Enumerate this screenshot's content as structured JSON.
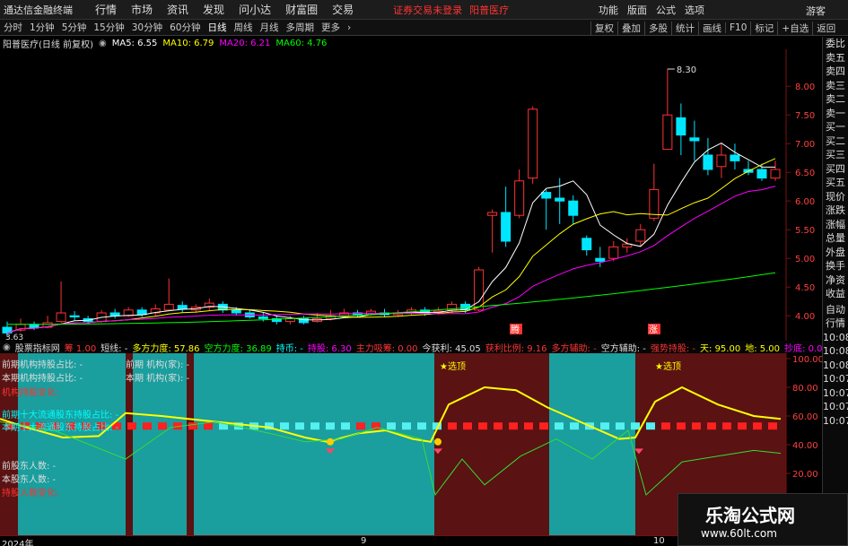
{
  "menubar": {
    "app_title": "通达信金融终端",
    "items": [
      "行情",
      "市场",
      "资讯",
      "发现",
      "问小达",
      "财富圈",
      "交易"
    ],
    "alert": "证券交易未登录",
    "stock": "阳普医疗",
    "right": [
      "功能",
      "版面",
      "公式",
      "选项",
      "游客"
    ]
  },
  "toolbar": {
    "periods": [
      "分时",
      "1分钟",
      "5分钟",
      "15分钟",
      "30分钟",
      "60分钟",
      "日线",
      "周线",
      "月线",
      "多周期",
      "更多"
    ],
    "active": "日线",
    "right": [
      "复权",
      "叠加",
      "多股",
      "统计",
      "画线",
      "F10",
      "标记",
      "+自选",
      "返回"
    ]
  },
  "main_chart": {
    "stock_label": "阳普医疗(日线 前复权)",
    "ma5": "MA5: 6.55",
    "ma10": "MA10: 6.79",
    "ma20": "MA20: 6.21",
    "ma60": "MA60: 4.76",
    "high_label": "8.30",
    "low_label": "3.63",
    "price_ticks": [
      "8.00",
      "7.50",
      "7.00",
      "6.50",
      "6.00",
      "5.50",
      "5.00",
      "4.50",
      "4.00",
      "3.50"
    ],
    "tag_teng": "腾",
    "tag_zhang": "涨",
    "colors": {
      "up": "#ff3232",
      "down": "#00e6ff",
      "ma5": "#ffffff",
      "ma10": "#ffff00",
      "ma20": "#ff00ff",
      "ma60": "#00ff00"
    }
  },
  "side": [
    "委比",
    "卖五",
    "卖四",
    "卖三",
    "卖二",
    "卖一",
    "买一",
    "买二",
    "买三",
    "买四",
    "买五",
    "现价",
    "涨跌",
    "涨幅",
    "总量",
    "外盘",
    "换手",
    "净资",
    "收益",
    "自动",
    "行情",
    "10:08",
    "10:08",
    "10:08",
    "10:07",
    "10:07",
    "10:07",
    "10:07"
  ],
  "indicator": {
    "name": "股票指标网",
    "chip": "筹 1.00",
    "short": "短线: -",
    "long_force": "多方力度: 57.86",
    "short_force": "空方力度: 36.89",
    "hold": "持币: -",
    "hold_stock": "持股: 6.30",
    "main_absorb": "主力吸筹: 0.00",
    "today_profit": "今获利: 45.05",
    "profit_ratio": "获利比例: 9.16",
    "long_assist": "多方辅助: -",
    "short_assist": "空方辅助: -",
    "strong_hold": "强势持股: -",
    "sky": "天: 95.00",
    "ground": "地: 5.00",
    "copy_bottom": "抄底: 0.00",
    "ticks": [
      "100.00",
      "80.00",
      "60.00",
      "40.00",
      "20.00"
    ],
    "select_top": "★选顶"
  },
  "left_labels": {
    "prev_inst": "前期机构持股占比: -",
    "cur_inst": "本期机构持股占比: -",
    "inst_change": "机构持股变化:",
    "prev_top10": "前期十大流通股东持股占比: -",
    "cur_top10": "本期十大流通股东持股占比: -",
    "prev_holders": "前股东人数: -",
    "cur_holders": "本股东人数: -",
    "holder_change": "持股人数变化:",
    "prev_inst2": "前期 机构(家): -",
    "cur_inst2": "本期 机构(家): -"
  },
  "dates": {
    "year": "2024年",
    "m9": "9",
    "m10": "10"
  },
  "watermark": {
    "title": "乐淘公式网",
    "url": "www.60lt.com"
  }
}
